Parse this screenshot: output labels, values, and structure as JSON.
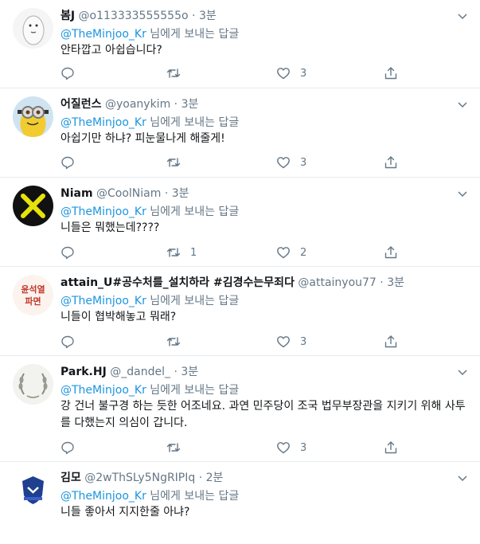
{
  "reply_prefix": "님에게 보내는 답글",
  "reply_to": "@TheMinjoo_Kr",
  "dot": "·",
  "tweets": [
    {
      "name": "봄J",
      "handle": "@o113333555555o",
      "time": "3분",
      "text": "안타깝고 아쉽습니다?",
      "reply_count": "",
      "retweet_count": "",
      "like_count": "3",
      "avatar": "rice-character-avatar"
    },
    {
      "name": "어질런스",
      "handle": "@yoanykim",
      "time": "3분",
      "text": "아쉽기만 하냐? 피눈물나게 해줄게!",
      "reply_count": "",
      "retweet_count": "",
      "like_count": "3",
      "avatar": "minion-avatar"
    },
    {
      "name": "Niam",
      "handle": "@CoolNiam",
      "time": "3분",
      "text": "니들은 뭐했는데????",
      "reply_count": "",
      "retweet_count": "1",
      "like_count": "2",
      "avatar": "yellow-x-avatar"
    },
    {
      "name": "attain_U#공수처를_설치하라 #김경수는무죄다",
      "handle": "@attainyou77",
      "time": "3분",
      "text": "니들이 협박해놓고 뭐래?",
      "reply_count": "",
      "retweet_count": "",
      "like_count": "3",
      "avatar": "stamp-text-avatar",
      "avatar_text_line1": "윤석열",
      "avatar_text_line2": "파면"
    },
    {
      "name": "Park.HJ",
      "handle": "@_dandel_",
      "time": "3분",
      "text": "강 건너 불구경 하는 듯한 어조네요. 과연 민주당이 조국 법무부장관을 지키기 위해 사투를 다했는지 의심이 갑니다.",
      "reply_count": "",
      "retweet_count": "",
      "like_count": "3",
      "avatar": "laurel-wreath-avatar"
    },
    {
      "name": "김모",
      "handle": "@2wThSLy5NgRIPIq",
      "time": "2분",
      "text": "니들 좋아서 지지한줄 아냐?",
      "reply_count": "",
      "retweet_count": "",
      "like_count": "",
      "avatar": "badge-avatar"
    }
  ],
  "colors": {
    "accent": "#1b95e0",
    "muted": "#657786",
    "text": "#14171a",
    "border": "#e6ecf0"
  },
  "icons": {
    "reply": "reply-icon",
    "retweet": "retweet-icon",
    "like": "heart-icon",
    "share": "share-icon",
    "more": "chevron-down-icon"
  }
}
